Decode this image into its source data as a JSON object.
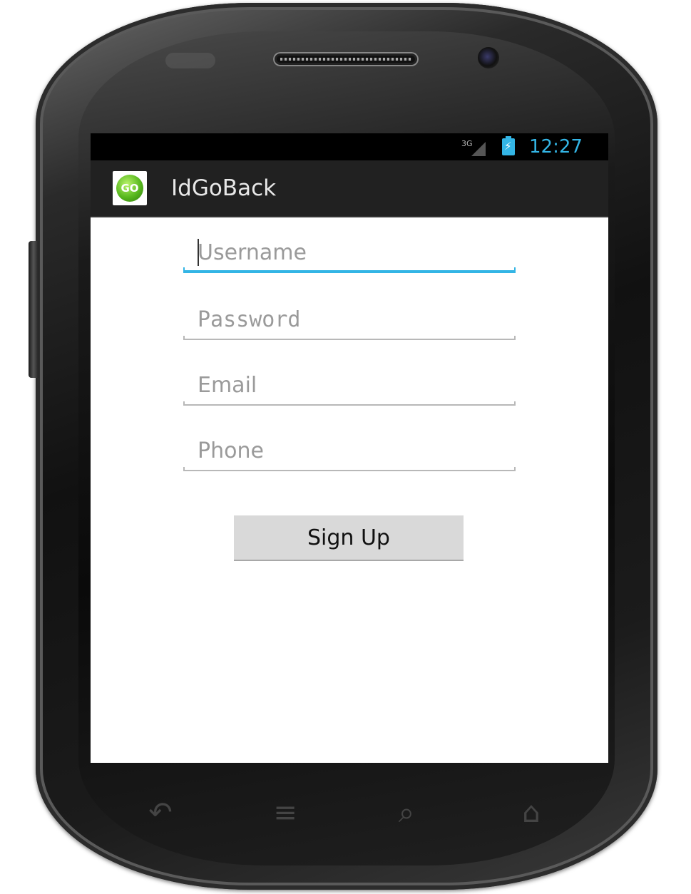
{
  "status_bar": {
    "network": "3G",
    "time": "12:27"
  },
  "action_bar": {
    "app_icon_text": "GO",
    "title": "IdGoBack"
  },
  "form": {
    "username": {
      "value": "",
      "placeholder": "Username"
    },
    "password": {
      "value": "",
      "placeholder": "Password"
    },
    "email": {
      "value": "",
      "placeholder": "Email"
    },
    "phone": {
      "value": "",
      "placeholder": "Phone"
    },
    "signup_label": "Sign Up"
  },
  "colors": {
    "accent": "#33b5e5",
    "action_bar": "#212121",
    "button": "#d9d9d9"
  },
  "nav_icons": [
    "back-icon",
    "menu-icon",
    "search-icon",
    "home-icon"
  ]
}
